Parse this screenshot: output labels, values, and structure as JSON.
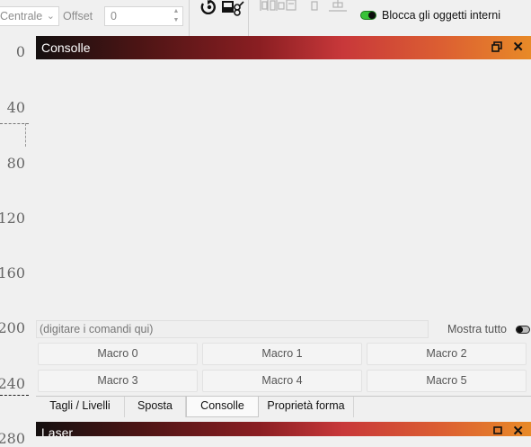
{
  "toolbar": {
    "align_value": "Centrale",
    "offset_label": "Offset",
    "offset_value": "0",
    "lock_label": "Blocca gli oggetti interni",
    "lock_enabled": true
  },
  "ruler": {
    "ticks": [
      "0",
      "40",
      "80",
      "120",
      "160",
      "200",
      "240",
      "280"
    ]
  },
  "console": {
    "title": "Consolle",
    "input_placeholder": "(digitare i comandi qui)",
    "show_all_label": "Mostra tutto",
    "show_all_enabled": false,
    "macros": [
      "Macro 0",
      "Macro 1",
      "Macro 2",
      "Macro 3",
      "Macro 4",
      "Macro 5"
    ]
  },
  "tabs": [
    {
      "label": "Tagli / Livelli",
      "active": false
    },
    {
      "label": "Sposta",
      "active": false
    },
    {
      "label": "Consolle",
      "active": true
    },
    {
      "label": "Proprietà forma",
      "active": false
    }
  ],
  "laser": {
    "title": "Laser"
  },
  "colors": {
    "title_gradient": [
      "#141010",
      "#8a1e22",
      "#c8383a",
      "#e88a28"
    ],
    "toggle_on": "#38c238"
  }
}
